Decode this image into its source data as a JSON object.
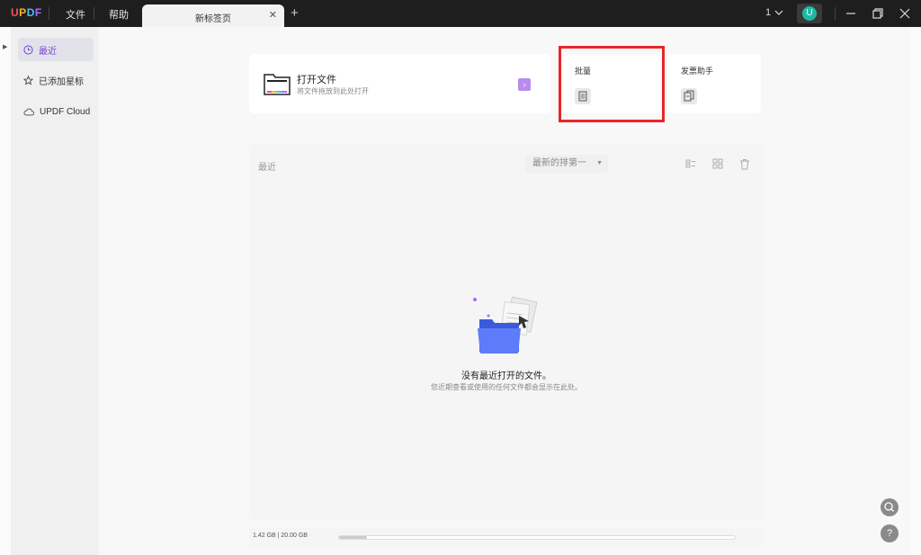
{
  "app": {
    "logo_letters": [
      "U",
      "P",
      "D",
      "F"
    ],
    "logo_colors": [
      "#ff4d6a",
      "#ffb21f",
      "#3dc2ff",
      "#a96bff"
    ]
  },
  "menu": {
    "file": "文件",
    "help": "帮助"
  },
  "tabs": [
    {
      "label": "新标签页"
    }
  ],
  "titlebar": {
    "page_count": "1",
    "avatar_initial": "U"
  },
  "sidebar": {
    "items": [
      {
        "label": "最近",
        "icon": "clock-icon",
        "active": true
      },
      {
        "label": "已添加星标",
        "icon": "star-icon",
        "active": false
      },
      {
        "label": "UPDF Cloud",
        "icon": "cloud-icon",
        "active": false
      }
    ]
  },
  "open_file": {
    "title": "打开文件",
    "subtitle": "将文件拖放到此处打开"
  },
  "quick_cards": [
    {
      "title": "批量",
      "icon": "batch-icon"
    },
    {
      "title": "发票助手",
      "icon": "invoice-icon"
    }
  ],
  "recent": {
    "title": "最近",
    "sort_label": "最新的排第一",
    "empty_title": "没有最近打开的文件。",
    "empty_subtitle": "您近期查看或使用的任何文件都会显示在此处。"
  },
  "storage": {
    "text": "1.42 GB | 20.00 GB",
    "used_fraction": 0.071
  },
  "colors": {
    "accent": "#7b45d8",
    "highlight": "#e8262a",
    "avatar": "#1fb9a3"
  }
}
